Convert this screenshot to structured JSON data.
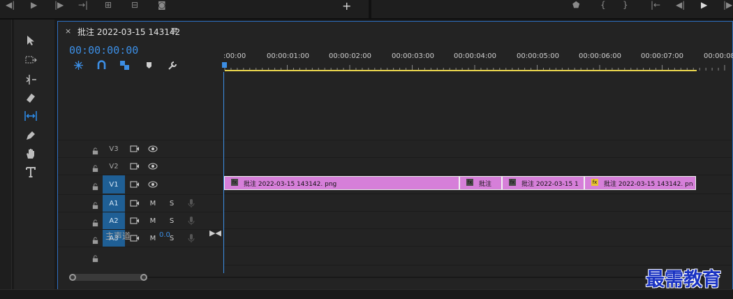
{
  "timeline": {
    "sequence_title": "批注 2022-03-15 143142",
    "close_symbol": "×",
    "menu_symbol": "≡",
    "timecode": "00:00:00:00"
  },
  "ruler": {
    "labels": [
      ":00:00",
      "00:00:01:00",
      "00:00:02:00",
      "00:00:03:00",
      "00:00:04:00",
      "00:00:05:00",
      "00:00:06:00",
      "00:00:07:00",
      "00:00:08"
    ]
  },
  "tracks": {
    "video": [
      {
        "name": "V3",
        "selected": false
      },
      {
        "name": "V2",
        "selected": false
      },
      {
        "name": "V1",
        "selected": true
      }
    ],
    "audio": [
      {
        "name": "A1",
        "mute": "M",
        "solo": "S",
        "selected": true
      },
      {
        "name": "A2",
        "mute": "M",
        "solo": "S",
        "selected": true
      },
      {
        "name": "A3",
        "mute": "M",
        "solo": "S",
        "selected": true
      }
    ],
    "master": {
      "label": "主声道",
      "value": "0.0"
    }
  },
  "clips": [
    {
      "label": "批注 2022-03-15  143142. png",
      "fx": "fx",
      "fx_color": "#4a4a4a"
    },
    {
      "label": "批注",
      "fx": "fx",
      "fx_color": "#4a4a4a"
    },
    {
      "label": "批注 2022-03-15 1",
      "fx": "fx",
      "fx_color": "#4a4a4a"
    },
    {
      "label": "批注 2022-03-15  143142. pn",
      "fx": "fx",
      "fx_color": "#e8c430"
    }
  ],
  "topbar": {
    "add_symbol": "+"
  },
  "watermark": "最需教育",
  "colors": {
    "accent_blue": "#3c8ee4",
    "clip_pink": "#d67fd9",
    "work_area_yellow": "#e8d44d",
    "selected_track": "#1f5f95"
  }
}
